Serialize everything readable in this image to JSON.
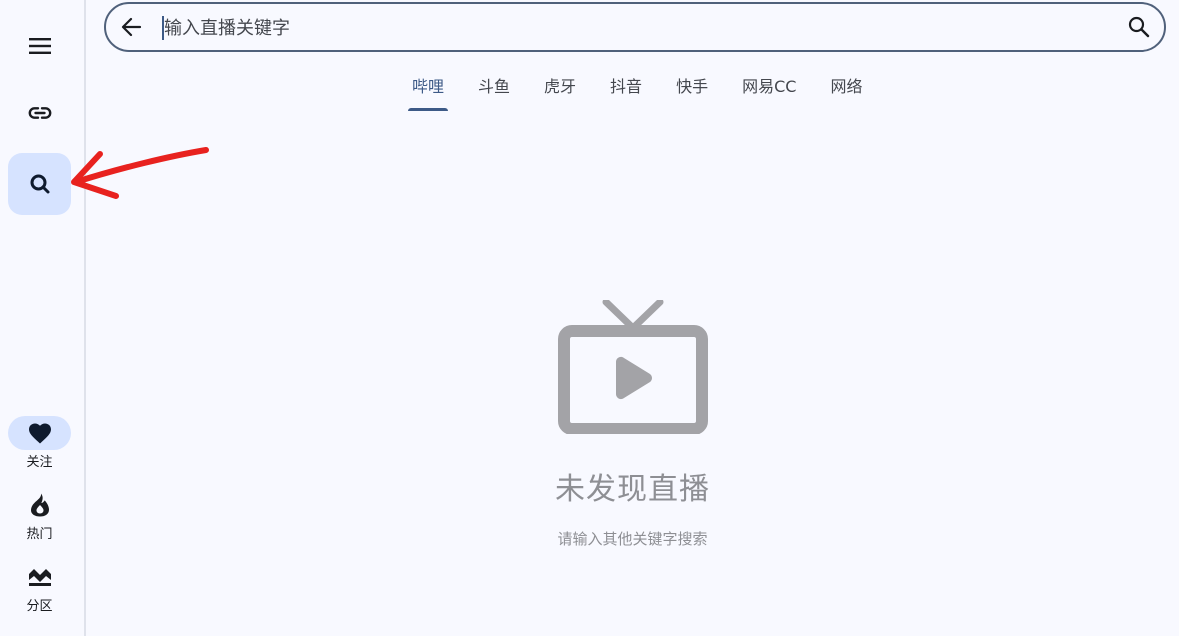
{
  "rail": {
    "menu_icon": "menu-icon",
    "link_icon": "link-icon",
    "search_icon": "search-icon",
    "destinations": [
      {
        "label": "关注",
        "icon": "heart-icon",
        "active": true
      },
      {
        "label": "热门",
        "icon": "flame-icon",
        "active": false
      },
      {
        "label": "分区",
        "icon": "mountain-icon",
        "active": false
      }
    ]
  },
  "search": {
    "placeholder": "输入直播关键字",
    "value": ""
  },
  "tabs": [
    {
      "label": "哔哩",
      "active": true
    },
    {
      "label": "斗鱼",
      "active": false
    },
    {
      "label": "虎牙",
      "active": false
    },
    {
      "label": "抖音",
      "active": false
    },
    {
      "label": "快手",
      "active": false
    },
    {
      "label": "网易CC",
      "active": false
    },
    {
      "label": "网络",
      "active": false
    }
  ],
  "empty": {
    "title": "未发现直播",
    "subtitle": "请输入其他关键字搜索",
    "icon": "tv-play-icon"
  },
  "colors": {
    "accent": "#3d5a87",
    "selected_bg": "#d6e3ff",
    "empty_gray": "#a3a3a7",
    "annotation": "#e8221f"
  }
}
